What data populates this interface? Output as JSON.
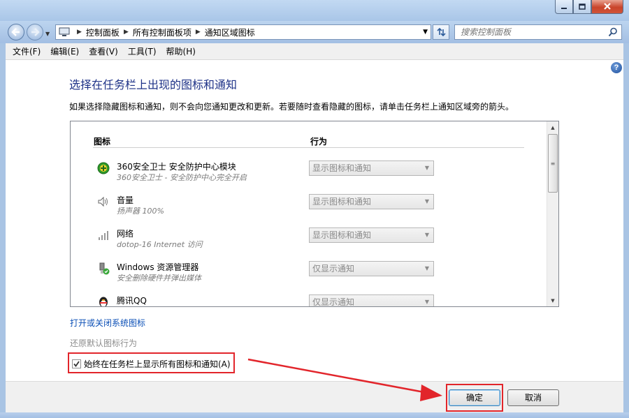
{
  "window": {
    "address_parts": [
      "控制面板",
      "所有控制面板项",
      "通知区域图标"
    ],
    "search_placeholder": "搜索控制面板"
  },
  "menu": [
    "文件(F)",
    "编辑(E)",
    "查看(V)",
    "工具(T)",
    "帮助(H)"
  ],
  "main": {
    "title": "选择在任务栏上出现的图标和通知",
    "description": "如果选择隐藏图标和通知，则不会向您通知更改和更新。若要随时查看隐藏的图标，请单击任务栏上通知区域旁的箭头。",
    "columns": [
      "图标",
      "行为"
    ],
    "items": [
      {
        "name": "360安全卫士 安全防护中心模块",
        "sub": "360安全卫士 - 安全防护中心完全开启",
        "behavior": "显示图标和通知",
        "icon": "360-shield-icon"
      },
      {
        "name": "音量",
        "sub": "扬声器 100%",
        "behavior": "显示图标和通知",
        "icon": "speaker-icon"
      },
      {
        "name": "网络",
        "sub": "dotop-16 Internet 访问",
        "behavior": "显示图标和通知",
        "icon": "network-icon"
      },
      {
        "name": "Windows 资源管理器",
        "sub": "安全删除硬件并弹出媒体",
        "behavior": "仅显示通知",
        "icon": "usb-eject-icon"
      },
      {
        "name": "腾讯QQ",
        "sub": "",
        "behavior": "仅显示通知",
        "icon": "qq-penguin-icon"
      }
    ],
    "link_system_icons": "打开或关闭系统图标",
    "link_restore": "还原默认图标行为",
    "checkbox_label": "始终在任务栏上显示所有图标和通知(A)",
    "checkbox_checked": true
  },
  "buttons": {
    "ok": "确定",
    "cancel": "取消"
  },
  "colors": {
    "title_blue": "#1e3287",
    "link_blue": "#0b4fb6",
    "annotation_red": "#e2252b"
  }
}
